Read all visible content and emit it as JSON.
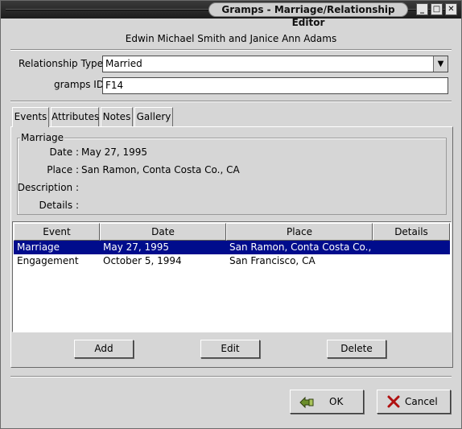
{
  "window": {
    "title": "Gramps - Marriage/Relationship Editor",
    "minimize_glyph": "_",
    "maximize_glyph": "□",
    "close_glyph": "✕"
  },
  "header": {
    "family_name": "Edwin Michael Smith and Janice Ann Adams"
  },
  "form": {
    "relationship_type_label": "Relationship Type",
    "relationship_type_value": "Married",
    "gramps_id_label": "gramps ID",
    "gramps_id_value": "F14"
  },
  "tabs": [
    {
      "label": "Events",
      "active": true
    },
    {
      "label": "Attributes",
      "active": false
    },
    {
      "label": "Notes",
      "active": false
    },
    {
      "label": "Gallery",
      "active": false
    }
  ],
  "event_detail": {
    "frame_title": "Marriage",
    "date_label": "Date :",
    "date_value": "May 27, 1995",
    "place_label": "Place :",
    "place_value": "San Ramon, Conta Costa Co., CA",
    "description_label": "Description :",
    "description_value": "",
    "details_label": "Details :",
    "details_value": ""
  },
  "events_table": {
    "columns": [
      "Event",
      "Date",
      "Place",
      "Details"
    ],
    "rows": [
      {
        "event": "Marriage",
        "date": "May 27, 1995",
        "place": "San Ramon, Conta Costa Co., CA",
        "details": "",
        "selected": true
      },
      {
        "event": "Engagement",
        "date": "October 5, 1994",
        "place": "San Francisco, CA",
        "details": "",
        "selected": false
      }
    ]
  },
  "list_buttons": {
    "add": "Add",
    "edit": "Edit",
    "delete": "Delete"
  },
  "dialog_buttons": {
    "ok": "OK",
    "cancel": "Cancel"
  },
  "colors": {
    "selection": "#000c8c",
    "dialog_bg": "#d6d6d6",
    "cancel_x": "#b01010",
    "ok_icon": "#5a7a2a"
  }
}
